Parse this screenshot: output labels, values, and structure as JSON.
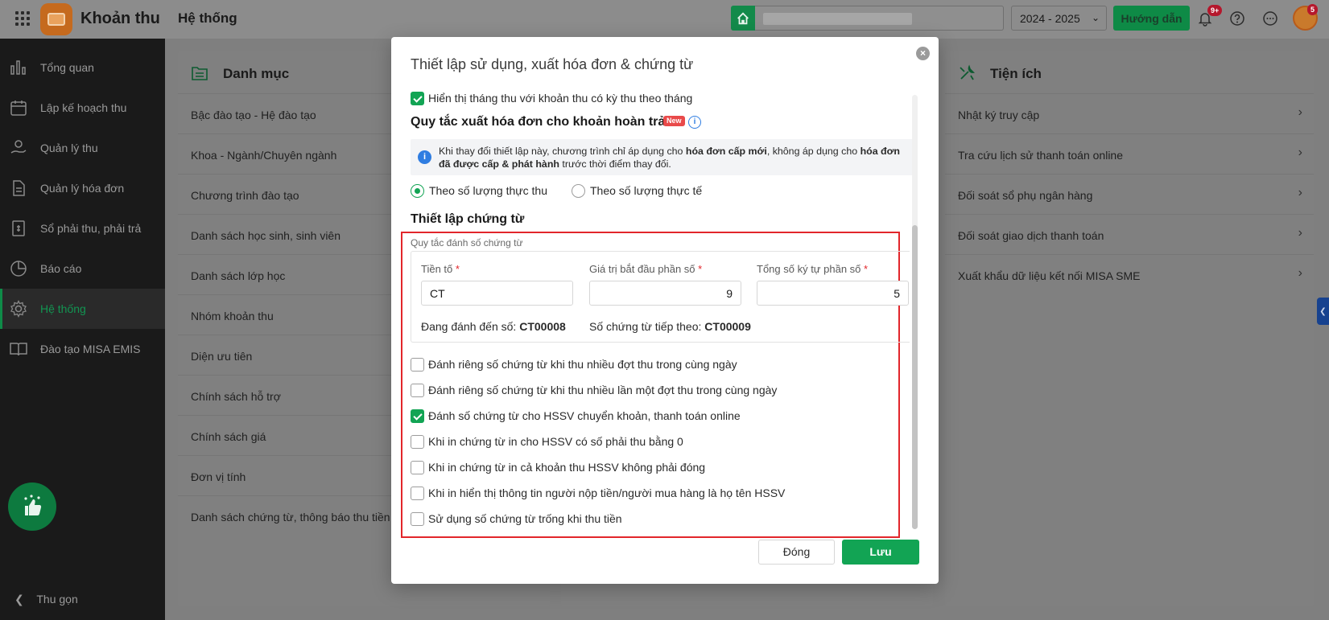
{
  "topbar": {
    "app_name": "Khoản thu",
    "section": "Hệ thống",
    "year": "2024 - 2025",
    "guide_label": "Hướng dẫn",
    "notif_badge": "9+",
    "avatar_badge": "5"
  },
  "sidebar": {
    "items": [
      {
        "label": "Tổng quan",
        "icon": "chart-bars-icon"
      },
      {
        "label": "Lập kế hoạch thu",
        "icon": "calendar-icon"
      },
      {
        "label": "Quản lý thu",
        "icon": "hand-money-icon"
      },
      {
        "label": "Quản lý hóa đơn",
        "icon": "document-icon"
      },
      {
        "label": "Sổ phải thu, phải trả",
        "icon": "ledger-icon"
      },
      {
        "label": "Báo cáo",
        "icon": "pie-chart-icon"
      },
      {
        "label": "Hệ thống",
        "icon": "gear-icon"
      },
      {
        "label": "Đào tạo MISA EMIS",
        "icon": "book-icon"
      }
    ],
    "active_index": 6,
    "collapse_label": "Thu gọn"
  },
  "catalog": {
    "title": "Danh mục",
    "rows": [
      "Bậc đào tạo - Hệ đào tạo",
      "Khoa - Ngành/Chuyên ngành",
      "Chương trình đào tạo",
      "Danh sách học sinh, sinh viên",
      "Danh sách lớp học",
      "Nhóm khoản thu",
      "Diện ưu tiên",
      "Chính sách hỗ trợ",
      "Chính sách giá",
      "Đơn vị tính",
      "Danh sách chứng từ, thông báo thu tiền"
    ]
  },
  "utilities": {
    "title": "Tiện ích",
    "rows": [
      "Nhật ký truy cập",
      "Tra cứu lịch sử thanh toán online",
      "Đối soát sổ phụ ngân hàng",
      "Đối soát giao dịch thanh toán",
      "Xuất khẩu dữ liệu kết nối MISA SME"
    ]
  },
  "modal": {
    "title": "Thiết lập sử dụng, xuất hóa đơn & chứng từ",
    "show_month_label": "Hiển thị tháng thu với khoản thu có kỳ thu theo tháng",
    "show_month_checked": true,
    "refund_title": "Quy tắc xuất hóa đơn cho khoản hoàn trả",
    "new_badge": "New",
    "notice_parts": {
      "p1": "Khi thay đổi thiết lập này, chương trình chỉ áp dụng cho ",
      "b1": "hóa đơn cấp mới",
      "p2": ", không áp dụng cho ",
      "b2": "hóa đơn đã được cấp & phát hành",
      "p3": " trước thời điểm thay đổi."
    },
    "radio_actual_collected": "Theo số lượng thực thu",
    "radio_actual": "Theo số lượng thực tế",
    "radio_selected": "actual_collected",
    "voucher_title": "Thiết lập chứng từ",
    "numbering_caption": "Quy tắc đánh số chứng từ",
    "prefix_label": "Tiền tố",
    "prefix_value": "CT",
    "start_label": "Giá trị bắt đầu phần số",
    "start_value": "9",
    "digits_label": "Tổng số ký tự phần số",
    "digits_value": "5",
    "current_label": "Đang đánh đến số:",
    "current_value": "CT00008",
    "next_label": "Số chứng từ tiếp theo:",
    "next_value": "CT00009",
    "options": [
      {
        "label": "Đánh riêng số chứng từ khi thu nhiều đợt thu trong cùng ngày",
        "checked": false
      },
      {
        "label": "Đánh riêng số chứng từ khi thu nhiều lần một đợt thu trong cùng ngày",
        "checked": false
      },
      {
        "label": "Đánh số chứng từ cho HSSV chuyển khoản, thanh toán online",
        "checked": true
      },
      {
        "label": "Khi in chứng từ in cho HSSV có số phải thu bằng 0",
        "checked": false
      },
      {
        "label": "Khi in chứng từ in cả khoản thu HSSV không phải đóng",
        "checked": false
      },
      {
        "label": "Khi in hiển thị thông tin người nộp tiền/người mua hàng là họ tên HSSV",
        "checked": false
      },
      {
        "label": "Sử dụng số chứng từ trống khi thu tiền",
        "checked": false
      }
    ],
    "close_label": "Đóng",
    "save_label": "Lưu"
  },
  "colors": {
    "accent": "#12a454",
    "danger_frame": "#e2262b",
    "info_blue": "#2f7de1"
  }
}
